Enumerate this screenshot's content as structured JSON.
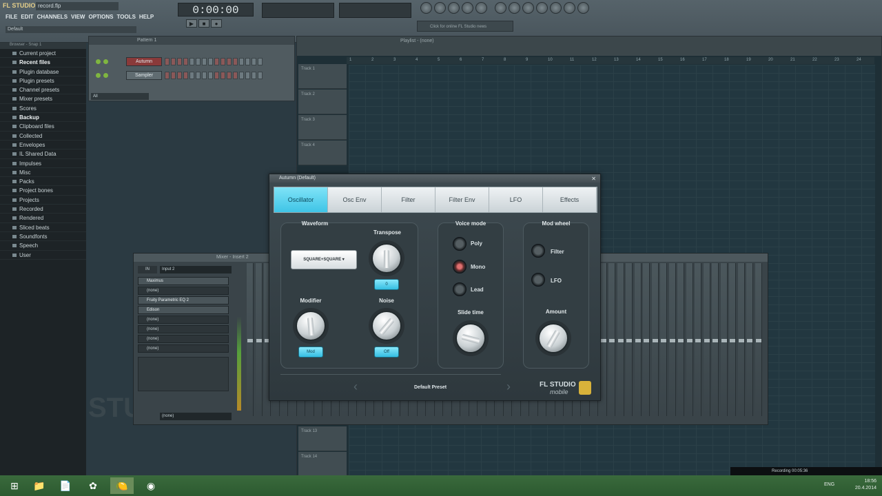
{
  "app": {
    "logo": "FL STUDIO",
    "project_file": "record.flp",
    "menu": [
      "FILE",
      "EDIT",
      "CHANNELS",
      "VIEW",
      "OPTIONS",
      "TOOLS",
      "HELP"
    ],
    "preset_field": "Default",
    "time": "0:00:00",
    "transport": [
      "▶",
      "■",
      "●"
    ],
    "hint": "Click for online FL Studio news"
  },
  "browser": {
    "header": "Browser - Snap 1",
    "items": [
      {
        "label": "Current project",
        "bold": false
      },
      {
        "label": "Recent files",
        "bold": true
      },
      {
        "label": "Plugin database",
        "bold": false
      },
      {
        "label": "Plugin presets",
        "bold": false
      },
      {
        "label": "Channel presets",
        "bold": false
      },
      {
        "label": "Mixer presets",
        "bold": false
      },
      {
        "label": "Scores",
        "bold": false
      },
      {
        "label": "Backup",
        "bold": true
      },
      {
        "label": "Clipboard files",
        "bold": false
      },
      {
        "label": "Collected",
        "bold": false
      },
      {
        "label": "Envelopes",
        "bold": false
      },
      {
        "label": "IL Shared Data",
        "bold": false
      },
      {
        "label": "Impulses",
        "bold": false
      },
      {
        "label": "Misc",
        "bold": false
      },
      {
        "label": "Packs",
        "bold": false
      },
      {
        "label": "Project bones",
        "bold": false
      },
      {
        "label": "Projects",
        "bold": false
      },
      {
        "label": "Recorded",
        "bold": false
      },
      {
        "label": "Rendered",
        "bold": false
      },
      {
        "label": "Sliced beats",
        "bold": false
      },
      {
        "label": "Soundfonts",
        "bold": false
      },
      {
        "label": "Speech",
        "bold": false
      },
      {
        "label": "User",
        "bold": false
      }
    ]
  },
  "rack": {
    "title": "Pattern 1",
    "channels": [
      "Autumn",
      "Sampler"
    ],
    "filter": "All"
  },
  "playlist": {
    "title": "Playlist - (none)",
    "tracks": [
      "Track 1",
      "Track 2",
      "Track 3",
      "Track 4"
    ],
    "tracks_bottom": [
      "Track 13",
      "Track 14"
    ],
    "ruler": [
      "1",
      "2",
      "3",
      "4",
      "5",
      "6",
      "7",
      "8",
      "9",
      "10",
      "11",
      "12",
      "13",
      "14",
      "15",
      "16",
      "17",
      "18",
      "19",
      "20",
      "21",
      "22",
      "23",
      "24"
    ]
  },
  "mixer": {
    "title": "Mixer - Insert 2",
    "input_label": "IN",
    "input": "Input 2",
    "output": "(none)",
    "fx_slots": [
      {
        "label": "Maximus",
        "on": true
      },
      {
        "label": "(none)",
        "on": false
      },
      {
        "label": "Fruity Parametric EQ 2",
        "on": true
      },
      {
        "label": "Edison",
        "on": true
      },
      {
        "label": "(none)",
        "on": false
      },
      {
        "label": "(none)",
        "on": false
      },
      {
        "label": "(none)",
        "on": false
      },
      {
        "label": "(none)",
        "on": false
      }
    ]
  },
  "synth": {
    "title": "Autumn (Default)",
    "tabs": [
      "Oscillator",
      "Osc Env",
      "Filter",
      "Filter Env",
      "LFO",
      "Effects"
    ],
    "active_tab": "Oscillator",
    "waveform_label": "Waveform",
    "waveform_value": "SQUARE+SQUARE ▾",
    "transpose_label": "Transpose",
    "transpose_value": "0",
    "modifier_label": "Modifier",
    "modifier_value": "Mod",
    "noise_label": "Noise",
    "noise_value": "Off",
    "voice_mode_label": "Voice mode",
    "voice_modes": [
      "Poly",
      "Mono",
      "Lead"
    ],
    "voice_mode_selected": "Mono",
    "slide_label": "Slide time",
    "mod_wheel_label": "Mod wheel",
    "mod_wheel_options": [
      "Filter",
      "LFO"
    ],
    "amount_label": "Amount",
    "preset_name": "Default Preset",
    "brand": "FL STUDIO",
    "brand_sub": "mobile"
  },
  "taskbar": {
    "icons": [
      "⊞",
      "📁",
      "📄",
      "✿",
      "🍋",
      "◉"
    ],
    "recording": "Recording 00:05:36",
    "tray_lang": "ENG",
    "clock_time": "18:56",
    "clock_date": "20.4.2014"
  },
  "watermark": "STU"
}
